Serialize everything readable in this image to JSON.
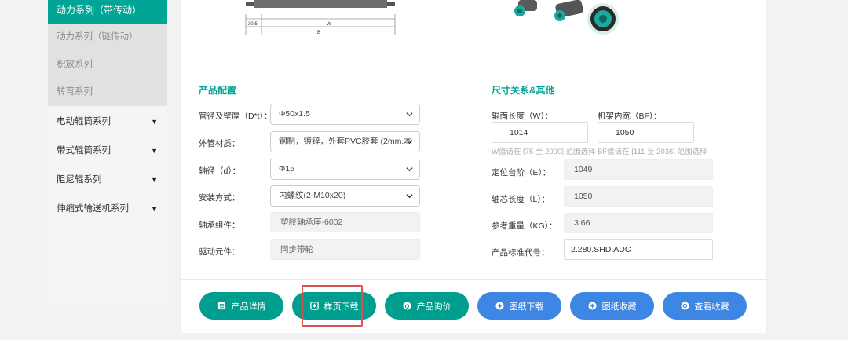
{
  "sidebar": {
    "active_item": "动力系列（带传动）",
    "sub_items": [
      "动力系列（链传动）",
      "积放系列",
      "转弯系列"
    ],
    "main_items": [
      "电动辊筒系列",
      "带式辊筒系列",
      "阻尼辊系列",
      "伸缩式输送机系列"
    ]
  },
  "drawing": {
    "dim1": "30.5",
    "dim2": "W",
    "dim3": "B"
  },
  "config": {
    "title": "产品配置",
    "rows": [
      {
        "label": "管径及壁厚（D*t）：",
        "value": "Φ50x1.5",
        "type": "select"
      },
      {
        "label": "外管材质：",
        "value": "钢制，镀锌，外套PVC胶套 (2mm,本",
        "type": "select"
      },
      {
        "label": "轴径（d）：",
        "value": "Φ15",
        "type": "select"
      },
      {
        "label": "安装方式：",
        "value": "内螺纹(2-M10x20)",
        "type": "select"
      },
      {
        "label": "轴承组件：",
        "value": "塑胶轴承座-6002",
        "type": "readonly"
      },
      {
        "label": "驱动元件：",
        "value": "同步带轮",
        "type": "readonly"
      }
    ]
  },
  "dimensions": {
    "title": "尺寸关系&其他",
    "w_label": "辊面长度（W）：",
    "w_value": "1014",
    "w_hint": "W值请在 [75 至 2000] 范围选择",
    "bf_label": "机架内宽（BF）：",
    "bf_value": "1050",
    "bf_hint": "BF值请在 [111 至 2036] 范围选择",
    "e_label": "定位台阶（E）：",
    "e_value": "1049",
    "l_label": "轴芯长度（L）：",
    "l_value": "1050",
    "kg_label": "参考重量（KG）：",
    "kg_value": "3.66",
    "code_label": "产品标准代号：",
    "code_value": "2.280.SHD.ADC"
  },
  "buttons": [
    {
      "label": "产品详情",
      "color": "#009e8e",
      "icon": "list-icon"
    },
    {
      "label": "样页下载",
      "color": "#009e8e",
      "icon": "download-icon"
    },
    {
      "label": "产品询价",
      "color": "#009e8e",
      "icon": "question-icon"
    },
    {
      "label": "图纸下载",
      "color": "#3e86e4",
      "icon": "arrow-down-circle-icon"
    },
    {
      "label": "图纸收藏",
      "color": "#3e86e4",
      "icon": "plus-circle-icon"
    },
    {
      "label": "查看收藏",
      "color": "#3e86e4",
      "icon": "eye-circle-icon"
    }
  ]
}
